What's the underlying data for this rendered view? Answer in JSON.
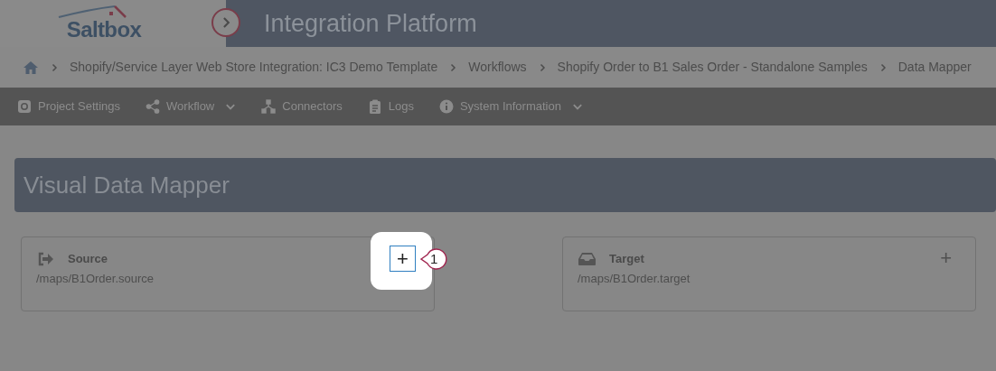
{
  "header": {
    "logo": "Saltbox",
    "title": "Integration Platform"
  },
  "breadcrumbs": [
    "Shopify/Service Layer Web Store Integration: IC3 Demo Template",
    "Workflows",
    "Shopify Order to B1 Sales Order - Standalone Samples",
    "Data Mapper"
  ],
  "toolbar": [
    {
      "kind": "settings",
      "label": "Project Settings",
      "dropdown": false
    },
    {
      "kind": "share",
      "label": "Workflow",
      "dropdown": true
    },
    {
      "kind": "connectors",
      "label": "Connectors",
      "dropdown": false
    },
    {
      "kind": "logs",
      "label": "Logs",
      "dropdown": false
    },
    {
      "kind": "info",
      "label": "System Information",
      "dropdown": true
    }
  ],
  "page_title": "Visual Data Mapper",
  "panels": [
    {
      "kind": "source",
      "title": "Source",
      "path": "/maps/B1Order.source",
      "add": "+",
      "highlighted": true,
      "callout": "1"
    },
    {
      "kind": "target",
      "title": "Target",
      "path": "/maps/B1Order.target",
      "add": "+",
      "highlighted": false
    }
  ]
}
